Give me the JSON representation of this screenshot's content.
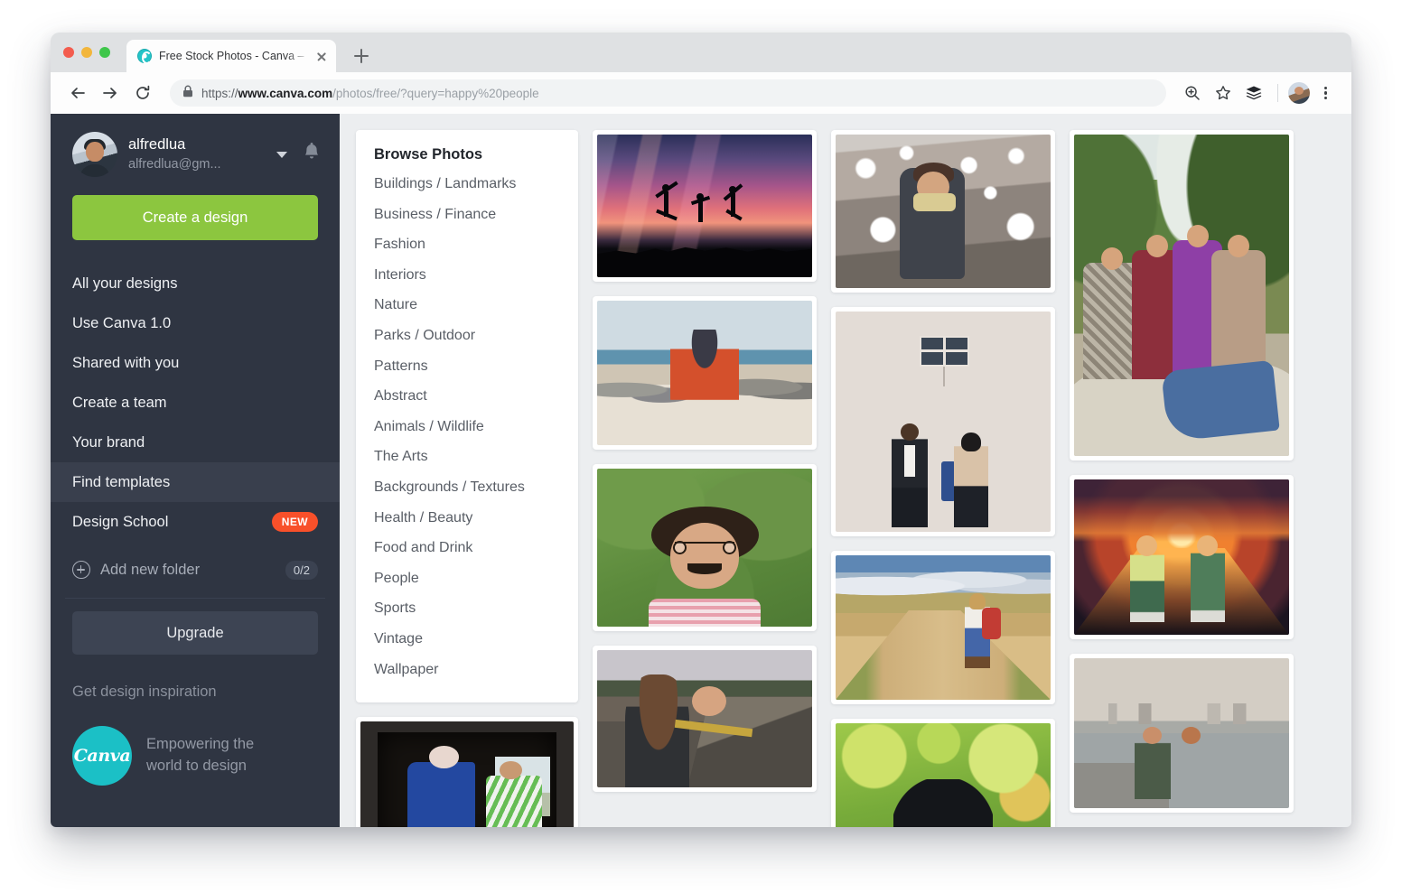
{
  "browser": {
    "tab": {
      "title": "Free Stock Photos - Canva – C",
      "favicon": "canva-favicon"
    },
    "new_tab_label": "+",
    "omnibox": {
      "scheme": "https://",
      "domain": "www.canva.com",
      "path": "/photos/free/?query=happy%20people",
      "lock_icon": "lock-icon"
    },
    "toolbar_icons": [
      "back-icon",
      "forward-icon",
      "reload-icon",
      "zoom-icon",
      "bookmark-star-icon",
      "extensions-stack-icon",
      "profile-avatar",
      "kebab-menu-icon"
    ]
  },
  "sidebar": {
    "user": {
      "name": "alfredlua",
      "email": "alfredlua@gm...",
      "avatar": "user-avatar",
      "caret": "chevron-down-icon",
      "bell": "notification-bell-icon"
    },
    "create_button": "Create a design",
    "items": [
      {
        "label": "All your designs",
        "active": false
      },
      {
        "label": "Use Canva 1.0",
        "active": false
      },
      {
        "label": "Shared with you",
        "active": false
      },
      {
        "label": "Create a team",
        "active": false
      },
      {
        "label": "Your brand",
        "active": false
      },
      {
        "label": "Find templates",
        "active": true
      },
      {
        "label": "Design School",
        "active": false,
        "badge": "NEW"
      }
    ],
    "add_folder": {
      "label": "Add new folder",
      "count": "0/2",
      "icon": "plus-circle-icon"
    },
    "upgrade_button": "Upgrade",
    "inspiration_label": "Get design inspiration",
    "brand": {
      "logo_text": "Canva",
      "tagline_line1": "Empowering the",
      "tagline_line2": "world to design"
    }
  },
  "categories": {
    "heading": "Browse Photos",
    "items": [
      "Buildings / Landmarks",
      "Business / Finance",
      "Fashion",
      "Interiors",
      "Nature",
      "Parks / Outdoor",
      "Patterns",
      "Abstract",
      "Animals / Wildlife",
      "The Arts",
      "Backgrounds / Textures",
      "Health / Beauty",
      "Food and Drink",
      "People",
      "Sports",
      "Vintage",
      "Wallpaper"
    ]
  },
  "photos": {
    "column_left_extra": [
      {
        "name": "photo-window-kids",
        "alt": "Two people lounging in a stone window frame"
      }
    ],
    "column_a": [
      {
        "name": "photo-jumping-silhouettes",
        "alt": "Three people jumping in silhouette against a pink sunset sky"
      },
      {
        "name": "photo-beach-family",
        "alt": "Family sitting on rocks at the beach"
      },
      {
        "name": "photo-funny-glasses",
        "alt": "Woman lying on grass wearing novelty glasses and moustache"
      },
      {
        "name": "photo-train-platform",
        "alt": "Smiling woman on a train platform"
      }
    ],
    "column_b": [
      {
        "name": "photo-snowball-fight",
        "alt": "People in a snowball fight"
      },
      {
        "name": "photo-couple-wall",
        "alt": "Two people standing against a beige wall under a window"
      },
      {
        "name": "photo-path-walker",
        "alt": "Woman with red backpack walking a dirt path through fields"
      },
      {
        "name": "photo-green-bokeh",
        "alt": "Person with dark hair against green bokeh background"
      }
    ],
    "column_c": [
      {
        "name": "photo-family-rock",
        "alt": "Family of four sitting on a rock outdoors"
      },
      {
        "name": "photo-children-sunset",
        "alt": "Two children holding hands at sunset"
      },
      {
        "name": "photo-couple-skyline",
        "alt": "Two people by the water with a city skyline"
      }
    ]
  }
}
